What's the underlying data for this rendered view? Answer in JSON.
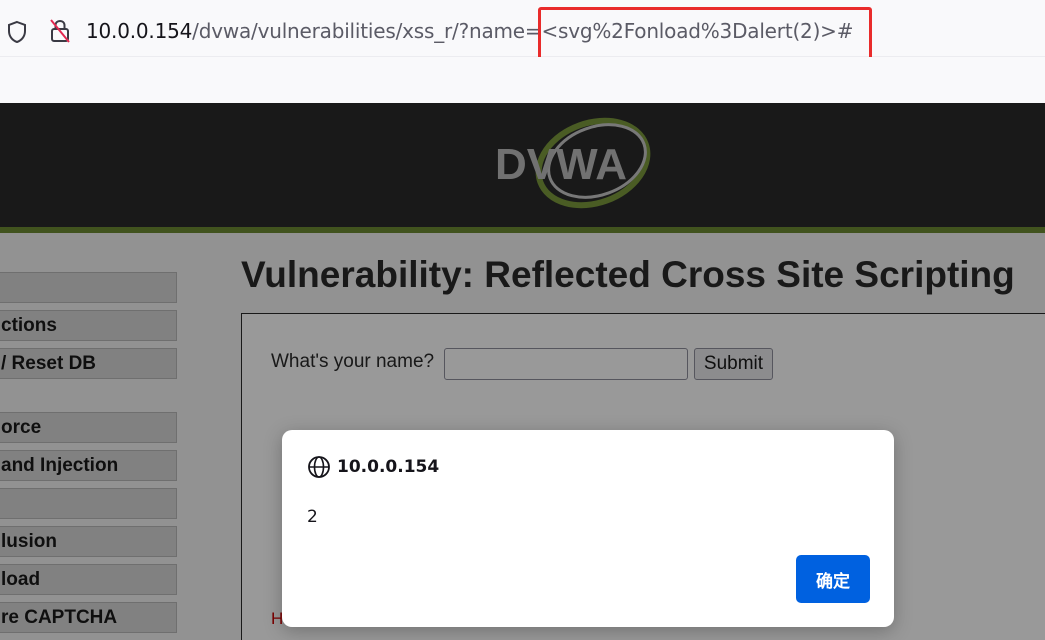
{
  "browser": {
    "url_host": "10.0.0.154",
    "url_path": "/dvwa/vulnerabilities/xss_r/?name=<svg%2Fonload%3Dalert(2)>#",
    "shield_icon": "shield-icon",
    "lock_icon": "insecure-lock-icon",
    "highlight_color": "#e92b2b"
  },
  "dvwa": {
    "logo_text": "DVWA",
    "accent_color": "#6d8a32",
    "menu": [
      {
        "label": ""
      },
      {
        "label": "ctions"
      },
      {
        "label": "/ Reset DB"
      },
      {
        "label": "orce"
      },
      {
        "label": "and Injection"
      },
      {
        "label": ""
      },
      {
        "label": "lusion"
      },
      {
        "label": "load"
      },
      {
        "label": "re CAPTCHA"
      }
    ],
    "title": "Vulnerability: Reflected Cross Site Scripting",
    "form": {
      "label": "What's your name?",
      "input_value": "",
      "submit_label": "Submit"
    },
    "help_text": "H"
  },
  "dialog": {
    "icon": "globe-icon",
    "origin": "10.0.0.154",
    "message": "2",
    "ok_label": "确定",
    "ok_color": "#0061e0"
  }
}
